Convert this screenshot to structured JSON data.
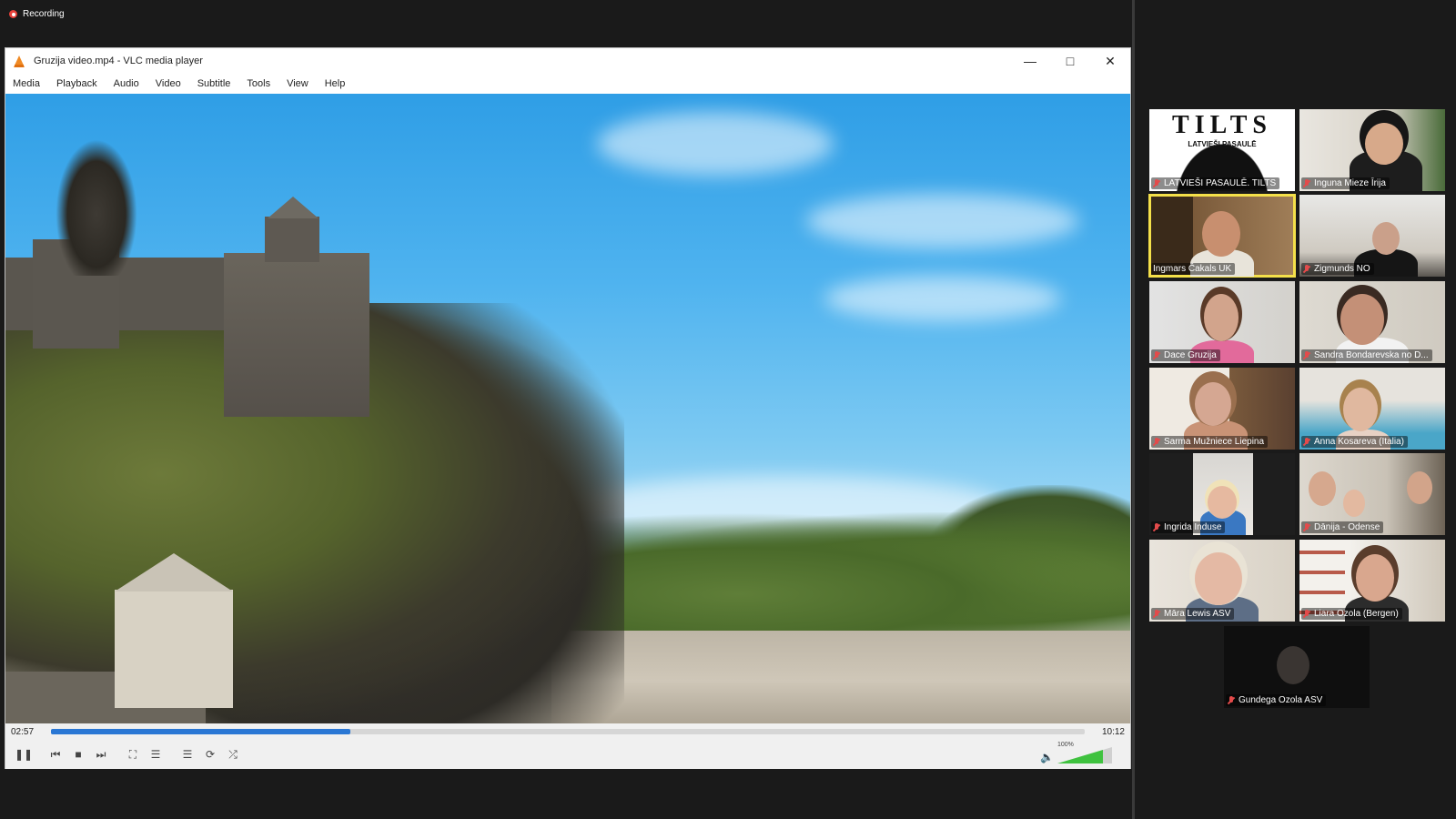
{
  "recording": {
    "label": "Recording"
  },
  "window": {
    "title": "Gruzija video.mp4 - VLC media player"
  },
  "menu": [
    "Media",
    "Playback",
    "Audio",
    "Video",
    "Subtitle",
    "Tools",
    "View",
    "Help"
  ],
  "player": {
    "elapsed": "02:57",
    "total": "10:12",
    "progress": 0.29,
    "volume_percent": "100%",
    "volume_level": 1.0
  },
  "participants": [
    {
      "name": "LATVIEŠI PASAULĒ. TILTS",
      "logo": "TILTS",
      "logo_sub": "LATVIEŠI PASAULĒ",
      "muted": true
    },
    {
      "name": "Inguna Mieze Īrija",
      "muted": true
    },
    {
      "name": "Ingmars Čakals UK",
      "muted": false,
      "active": true
    },
    {
      "name": "Zigmunds NO",
      "muted": true
    },
    {
      "name": "Dace Gruzija",
      "muted": true
    },
    {
      "name": "Sandra Bondarevska  no D...",
      "muted": true
    },
    {
      "name": "Sarma Mužniece Liepina",
      "muted": true
    },
    {
      "name": "Anna Kosareva (Italia)",
      "muted": true
    },
    {
      "name": "Ingrida Induse",
      "muted": true
    },
    {
      "name": "Dānija - Odense",
      "muted": true
    },
    {
      "name": "Māra Lewis ASV",
      "muted": true
    },
    {
      "name": "Liara Ozola (Bergen)",
      "muted": true
    },
    {
      "name": "Gundega Ozola ASV",
      "muted": true
    }
  ]
}
